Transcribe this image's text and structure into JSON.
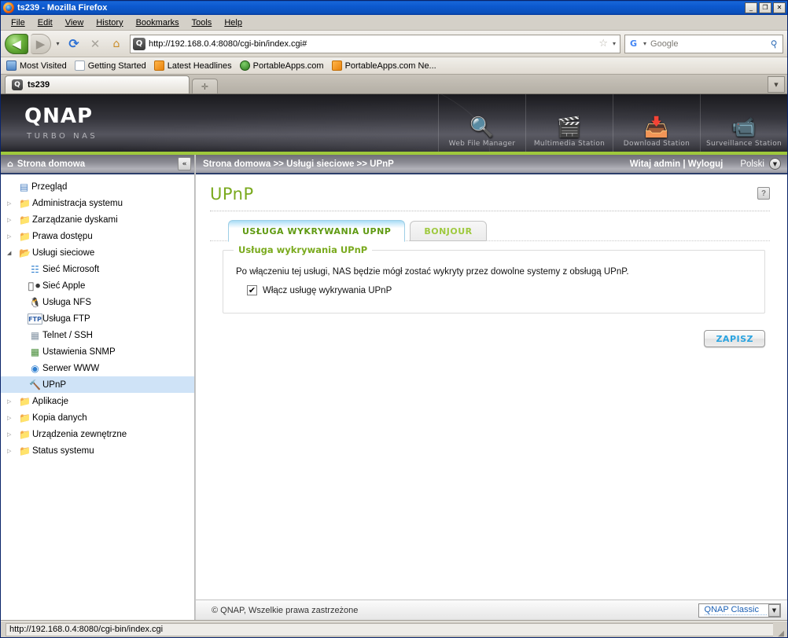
{
  "browser": {
    "title": "ts239 - Mozilla Firefox",
    "window_buttons": {
      "minimize": "_",
      "maximize": "❐",
      "close": "✕"
    },
    "menu": [
      "File",
      "Edit",
      "View",
      "History",
      "Bookmarks",
      "Tools",
      "Help"
    ],
    "nav": {
      "back_icon": "◀",
      "forward_icon": "▶",
      "dropdown_icon": "▾",
      "reload_icon": "⟳",
      "stop_icon": "✕",
      "home_icon": "⌂"
    },
    "url": "http://192.168.0.4:8080/cgi-bin/index.cgi#",
    "url_favicon": "Q",
    "bookmark_star": "☆",
    "search_placeholder": "Google",
    "search_engine_letter": "G",
    "bookmarks": [
      {
        "label": "Most Visited",
        "icon": "bookmark-blue-icon"
      },
      {
        "label": "Getting Started",
        "icon": "page-icon"
      },
      {
        "label": "Latest Headlines",
        "icon": "rss-icon"
      },
      {
        "label": "PortableApps.com",
        "icon": "shield-icon"
      },
      {
        "label": "PortableApps.com Ne...",
        "icon": "rss-icon"
      }
    ],
    "tab": {
      "label": "ts239",
      "favicon": "Q"
    },
    "new_tab_icon": "✛",
    "tab_list_icon": "▼",
    "status_url": "http://192.168.0.4:8080/cgi-bin/index.cgi"
  },
  "qnap": {
    "logo": "QNAP",
    "tagline": "TURBO NAS",
    "apps": [
      {
        "label": "Web File Manager",
        "glyph": "🔍"
      },
      {
        "label": "Multimedia Station",
        "glyph": "🎬"
      },
      {
        "label": "Download Station",
        "glyph": "📥"
      },
      {
        "label": "Surveillance Station",
        "glyph": "📹"
      }
    ],
    "accent_green": "#9fc93c",
    "title_green": "#7aaa1e"
  },
  "sidebar": {
    "header": "Strona domowa",
    "home_icon": "⌂",
    "collapse_icon": "«",
    "items": [
      {
        "label": "Przegląd",
        "icon": "overview-icon",
        "glyph": "▤",
        "level": 0,
        "arrow": "",
        "selected": false
      },
      {
        "label": "Administracja systemu",
        "icon": "folder-icon",
        "glyph": "📁",
        "level": 0,
        "arrow": "▷",
        "selected": false
      },
      {
        "label": "Zarządzanie dyskami",
        "icon": "folder-icon",
        "glyph": "📁",
        "level": 0,
        "arrow": "▷",
        "selected": false
      },
      {
        "label": "Prawa dostępu",
        "icon": "folder-icon",
        "glyph": "📁",
        "level": 0,
        "arrow": "▷",
        "selected": false
      },
      {
        "label": "Usługi sieciowe",
        "icon": "folder-open-icon",
        "glyph": "📂",
        "level": 0,
        "arrow": "◢",
        "selected": false
      },
      {
        "label": "Sieć Microsoft",
        "icon": "windows-icon",
        "glyph": "⊞",
        "level": 1,
        "arrow": "",
        "selected": false
      },
      {
        "label": "Sieć Apple",
        "icon": "apple-icon",
        "glyph": "",
        "level": 1,
        "arrow": "",
        "selected": false
      },
      {
        "label": "Usługa NFS",
        "icon": "linux-penguin-icon",
        "glyph": "🐧",
        "level": 1,
        "arrow": "",
        "selected": false
      },
      {
        "label": "Usługa FTP",
        "icon": "ftp-icon",
        "glyph": "F",
        "level": 1,
        "arrow": "",
        "selected": false
      },
      {
        "label": "Telnet / SSH",
        "icon": "terminal-icon",
        "glyph": "▧",
        "level": 1,
        "arrow": "",
        "selected": false
      },
      {
        "label": "Ustawienia SNMP",
        "icon": "snmp-icon",
        "glyph": "▦",
        "level": 1,
        "arrow": "",
        "selected": false
      },
      {
        "label": "Serwer WWW",
        "icon": "globe-icon",
        "glyph": "◉",
        "level": 1,
        "arrow": "",
        "selected": false
      },
      {
        "label": "UPnP",
        "icon": "upnp-icon",
        "glyph": "⚡",
        "level": 1,
        "arrow": "",
        "selected": true
      },
      {
        "label": "Aplikacje",
        "icon": "folder-icon",
        "glyph": "📁",
        "level": 0,
        "arrow": "▷",
        "selected": false
      },
      {
        "label": "Kopia danych",
        "icon": "folder-icon",
        "glyph": "📁",
        "level": 0,
        "arrow": "▷",
        "selected": false
      },
      {
        "label": "Urządzenia zewnętrzne",
        "icon": "folder-icon",
        "glyph": "📁",
        "level": 0,
        "arrow": "▷",
        "selected": false
      },
      {
        "label": "Status systemu",
        "icon": "folder-icon",
        "glyph": "📁",
        "level": 0,
        "arrow": "▷",
        "selected": false
      }
    ]
  },
  "topbar": {
    "breadcrumb": "Strona domowa >> Usługi sieciowe >> UPnP",
    "welcome": "Witaj admin | Wyloguj",
    "language": "Polski",
    "language_arrow": "▼"
  },
  "main": {
    "page_title": "UPnP",
    "help_icon": "?",
    "tabs": [
      {
        "label": "USŁUGA WYKRYWANIA UPNP",
        "active": true
      },
      {
        "label": "BONJOUR",
        "active": false
      }
    ],
    "panel": {
      "legend": "Usługa wykrywania UPnP",
      "description": "Po włączeniu tej usługi, NAS będzie mógł zostać wykryty przez dowolne systemy z obsługą UPnP.",
      "checkbox_label": "Włącz usługę wykrywania UPnP",
      "checkbox_checked": true,
      "checkbox_mark": "✔"
    },
    "save_button": "ZAPISZ"
  },
  "footer": {
    "copyright": "© QNAP, Wszelkie prawa zastrzeżone",
    "theme": "QNAP Classic",
    "theme_arrow": "▼"
  }
}
